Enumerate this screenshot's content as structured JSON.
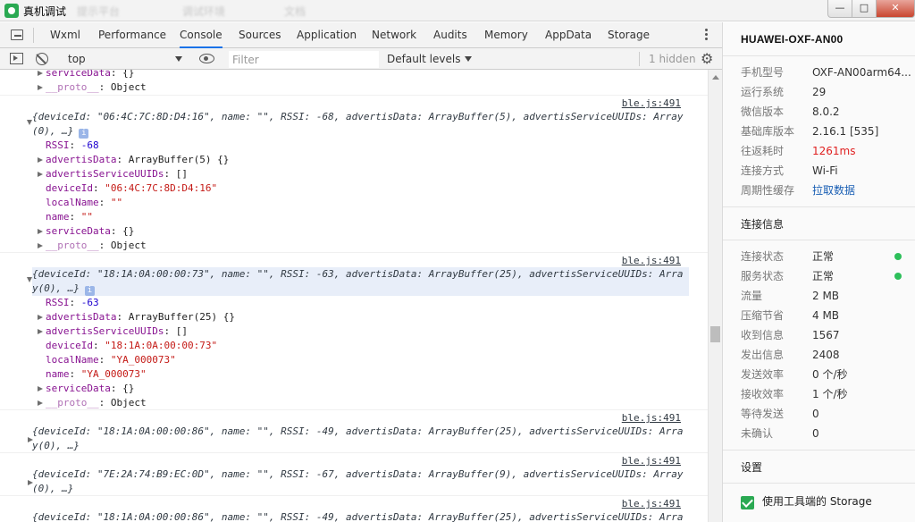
{
  "window": {
    "title": "真机调试",
    "ghost_tabs": [
      "提示平台",
      "调试环境",
      "文档"
    ],
    "min_label": "—",
    "max_label": "□",
    "close_label": "✕"
  },
  "tabs": [
    "Wxml",
    "Performance",
    "Console",
    "Sources",
    "Application",
    "Network",
    "Audits",
    "Memory",
    "AppData",
    "Storage"
  ],
  "active_tab": "Console",
  "toolbar": {
    "context": "top",
    "filter_placeholder": "Filter",
    "levels": "Default levels",
    "hidden": "1 hidden"
  },
  "console": {
    "tail": {
      "serviceData": "{}",
      "proto": "Object"
    },
    "entries": [
      {
        "source": "ble.js:491",
        "expanded": true,
        "summary_line1": "{deviceId: \"06:4C:7C:8D:D4:16\", name: \"\", RSSI: -68, advertisData: ArrayBuffer(5), advertisServiceUUIDs: Array",
        "summary_line2": "(0), …}",
        "RSSI": "-68",
        "advertisData": "ArrayBuffer(5) {}",
        "advertisServiceUUIDs": "[]",
        "deviceId": "\"06:4C:7C:8D:D4:16\"",
        "localName": "\"\"",
        "name": "\"\"",
        "serviceData": "{}",
        "proto": "Object"
      },
      {
        "source": "ble.js:491",
        "expanded": true,
        "selected": true,
        "summary_line1": "{deviceId: \"18:1A:0A:00:00:73\", name: \"\", RSSI: -63, advertisData: ArrayBuffer(25), advertisServiceUUIDs: Arra",
        "summary_line2": "y(0), …}",
        "RSSI": "-63",
        "advertisData": "ArrayBuffer(25) {}",
        "advertisServiceUUIDs": "[]",
        "deviceId": "\"18:1A:0A:00:00:73\"",
        "localName": "\"YA_000073\"",
        "name": "\"YA_000073\"",
        "serviceData": "{}",
        "proto": "Object"
      },
      {
        "source": "ble.js:491",
        "summary_line1": "{deviceId: \"18:1A:0A:00:00:86\", name: \"\", RSSI: -49, advertisData: ArrayBuffer(25), advertisServiceUUIDs: Arra",
        "summary_line2": "y(0), …}"
      },
      {
        "source": "ble.js:491",
        "summary_line1": "{deviceId: \"7E:2A:74:B9:EC:0D\", name: \"\", RSSI: -67, advertisData: ArrayBuffer(9), advertisServiceUUIDs: Array",
        "summary_line2": "(0), …}"
      },
      {
        "source": "ble.js:491",
        "summary_line1": "{deviceId: \"18:1A:0A:00:00:86\", name: \"\", RSSI: -49, advertisData: ArrayBuffer(25), advertisServiceUUIDs: Arra"
      }
    ]
  },
  "panel": {
    "device": "HUAWEI-OXF-AN00",
    "info": [
      {
        "label": "手机型号",
        "value": "OXF-AN00arm64..."
      },
      {
        "label": "运行系统",
        "value": "29"
      },
      {
        "label": "微信版本",
        "value": "8.0.2"
      },
      {
        "label": "基础库版本",
        "value": "2.16.1 [535]"
      },
      {
        "label": "往返耗时",
        "value": "1261ms"
      },
      {
        "label": "连接方式",
        "value": "Wi-Fi"
      },
      {
        "label": "周期性缓存",
        "value": "拉取数据"
      }
    ],
    "conn_title": "连接信息",
    "conn": [
      {
        "label": "连接状态",
        "value": "正常"
      },
      {
        "label": "服务状态",
        "value": "正常"
      },
      {
        "label": "流量",
        "value": "2 MB"
      },
      {
        "label": "压缩节省",
        "value": "4 MB"
      },
      {
        "label": "收到信息",
        "value": "1567"
      },
      {
        "label": "发出信息",
        "value": "2408"
      },
      {
        "label": "发送效率",
        "value": "0 个/秒"
      },
      {
        "label": "接收效率",
        "value": "1 个/秒"
      },
      {
        "label": "等待发送",
        "value": "0"
      },
      {
        "label": "未确认",
        "value": "0"
      }
    ],
    "settings_title": "设置",
    "storage_label": "使用工具端的 Storage",
    "status_color": "#2dbf5a",
    "latency_color": "#e02020"
  }
}
